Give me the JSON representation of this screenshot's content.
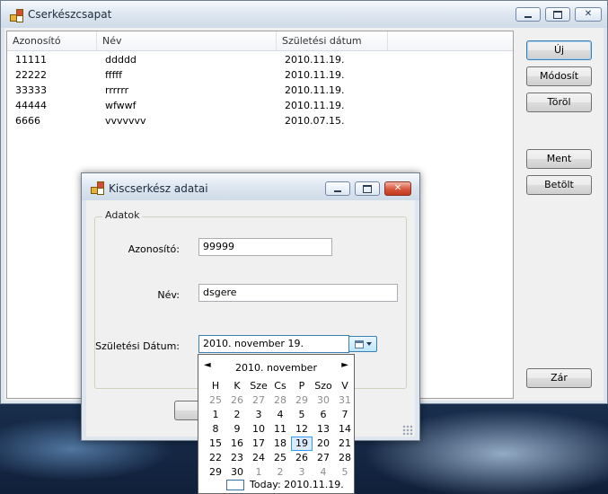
{
  "main_window": {
    "title": "Cserkészcsapat",
    "list": {
      "columns": [
        "Azonosító",
        "Név",
        "Születési dátum"
      ],
      "rows": [
        {
          "id": "11111",
          "name": "ddddd",
          "birth": "2010.11.19."
        },
        {
          "id": "22222",
          "name": "fffff",
          "birth": "2010.11.19."
        },
        {
          "id": "33333",
          "name": "rrrrrr",
          "birth": "2010.11.19."
        },
        {
          "id": "44444",
          "name": "wfwwf",
          "birth": "2010.11.19."
        },
        {
          "id": "6666",
          "name": "vvvvvvv",
          "birth": "2010.07.15."
        }
      ]
    },
    "buttons": {
      "new": "Új",
      "modify": "Módosít",
      "delete": "Töröl",
      "save": "Ment",
      "load": "Betölt",
      "close": "Zár"
    }
  },
  "dialog": {
    "title": "Kiscserkész adatai",
    "group_caption": "Adatok",
    "id_label": "Azonosító:",
    "id_value": "99999",
    "name_label": "Név:",
    "name_value": "dsgere",
    "birth_label": "Születési Dátum:",
    "birth_value": "2010.  november  19."
  },
  "calendar": {
    "month_title": "2010. november",
    "weekdays": [
      "H",
      "K",
      "Sze",
      "Cs",
      "P",
      "Szo",
      "V"
    ],
    "weeks": [
      [
        "25",
        "26",
        "27",
        "28",
        "29",
        "30",
        "31"
      ],
      [
        "1",
        "2",
        "3",
        "4",
        "5",
        "6",
        "7"
      ],
      [
        "8",
        "9",
        "10",
        "11",
        "12",
        "13",
        "14"
      ],
      [
        "15",
        "16",
        "17",
        "18",
        "19",
        "20",
        "21"
      ],
      [
        "22",
        "23",
        "24",
        "25",
        "26",
        "27",
        "28"
      ],
      [
        "29",
        "30",
        "1",
        "2",
        "3",
        "4",
        "5"
      ]
    ],
    "selected_day": "19",
    "today_label": "Today: 2010.11.19.",
    "prev_icon": "chevron-left-icon",
    "next_icon": "chevron-right-icon"
  }
}
